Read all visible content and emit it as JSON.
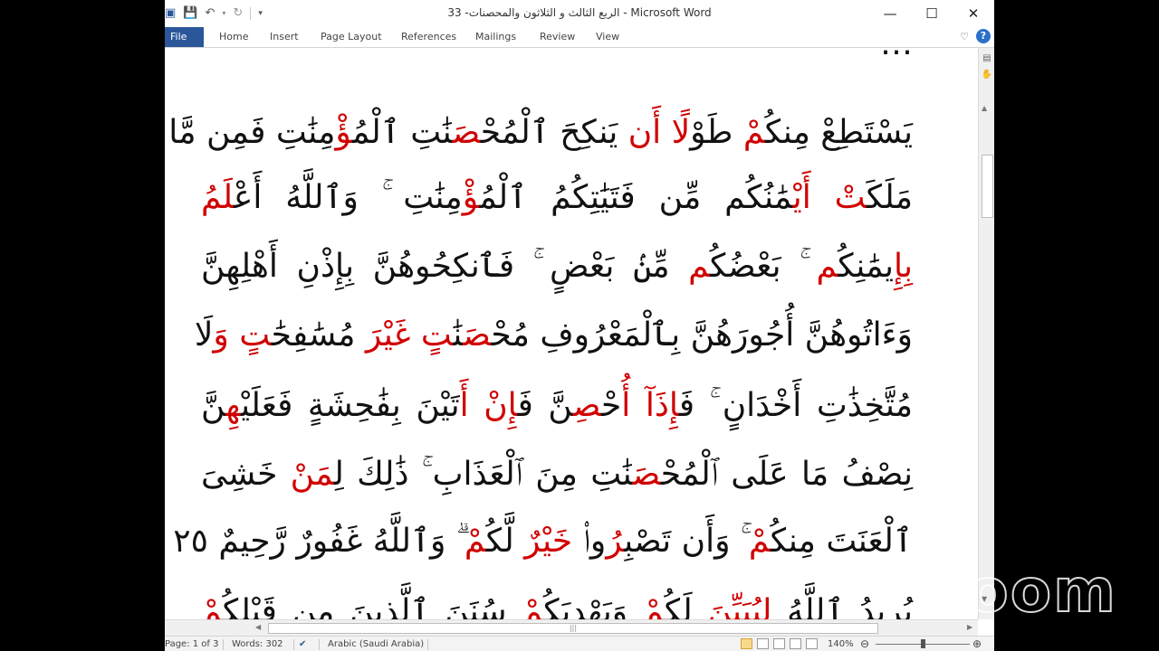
{
  "window": {
    "title": "الربع  الثالث و الثلاثون والمحصنات- 33  -  Microsoft Word"
  },
  "ribbon": {
    "tabs": [
      "File",
      "Home",
      "Insert",
      "Page Layout",
      "References",
      "Mailings",
      "Review",
      "View"
    ]
  },
  "document": {
    "lines": [
      [
        {
          "t": "…",
          "r": false
        }
      ],
      [
        {
          "t": "يَسْتَطِعْ مِنكُ",
          "r": false
        },
        {
          "t": "مْ",
          "r": true
        },
        {
          "t": " طَوْ",
          "r": false
        },
        {
          "t": "لًا أَن",
          "r": true
        },
        {
          "t": " يَنكِحَ ٱلْمُحْ",
          "r": false
        },
        {
          "t": "صَ",
          "r": true
        },
        {
          "t": "نَٰتِ ٱلْمُ",
          "r": false
        },
        {
          "t": "ؤْ",
          "r": true
        },
        {
          "t": "مِنَٰتِ فَمِن مَّا",
          "r": false
        }
      ],
      [
        {
          "t": "مَلَكَ",
          "r": false
        },
        {
          "t": "تْ أَيْ",
          "r": true
        },
        {
          "t": "مَٰنُكُم مِّن فَتَيَٰتِكُمُ ٱلْمُ",
          "r": false
        },
        {
          "t": "ؤْ",
          "r": true
        },
        {
          "t": "مِنَٰتِ ۚ وَٱللَّهُ أَعْ",
          "r": false
        },
        {
          "t": "لَمُ",
          "r": true
        }
      ],
      [
        {
          "t": "بِإِ",
          "r": true
        },
        {
          "t": "يمَٰنِكُ",
          "r": false
        },
        {
          "t": "م",
          "r": true
        },
        {
          "t": " ۚ بَعْضُكُ",
          "r": false
        },
        {
          "t": "م",
          "r": true
        },
        {
          "t": " مِّنۢ بَعْضٍ ۚ فَٱنكِحُوهُنَّ بِإِذْنِ أَهْلِهِنَّ",
          "r": false
        }
      ],
      [
        {
          "t": "وَءَاتُوهُنَّ أُجُورَهُنَّ بِٱلْمَعْرُوفِ مُحْ",
          "r": false
        },
        {
          "t": "صَ",
          "r": true
        },
        {
          "t": "نَٰ",
          "r": false
        },
        {
          "t": "تٍ غَيْرَ",
          "r": true
        },
        {
          "t": " مُسَٰفِحَٰ",
          "r": false
        },
        {
          "t": "تٍ وَ",
          "r": true
        },
        {
          "t": "لَا",
          "r": false
        }
      ],
      [
        {
          "t": "مُتَّخِذَٰتِ أَخْدَانٍ ۚ فَ",
          "r": false
        },
        {
          "t": "إِذَآ أُ",
          "r": true
        },
        {
          "t": "حْ",
          "r": false
        },
        {
          "t": "صِ",
          "r": true
        },
        {
          "t": "نَّ فَ",
          "r": false
        },
        {
          "t": "إِنْ أَ",
          "r": true
        },
        {
          "t": "تَيْنَ بِفَٰحِشَةٍ فَعَلَيْ",
          "r": false
        },
        {
          "t": "هِ",
          "r": true
        },
        {
          "t": "نَّ",
          "r": false
        }
      ],
      [
        {
          "t": "نِصْفُ مَا عَلَى ٱلْمُحْ",
          "r": false
        },
        {
          "t": "صَ",
          "r": true
        },
        {
          "t": "نَٰتِ مِنَ ٱلْعَذَابِ ۚ ذَٰلِكَ لِ",
          "r": false
        },
        {
          "t": "مَنْ",
          "r": true
        },
        {
          "t": " خَ",
          "r": false
        },
        {
          "t": "",
          "r": true
        },
        {
          "t": "شِىَ",
          "r": false
        }
      ],
      [
        {
          "t": "ٱلْعَنَتَ مِنكُ",
          "r": false
        },
        {
          "t": "مْ",
          "r": true
        },
        {
          "t": " ۚ وَأَن تَصْبِ",
          "r": false
        },
        {
          "t": "رُ",
          "r": true
        },
        {
          "t": "وا۟ ",
          "r": false
        },
        {
          "t": "خَيْرٌ",
          "r": true
        },
        {
          "t": " لَّكُ",
          "r": false
        },
        {
          "t": "مْ",
          "r": true
        },
        {
          "t": " ۗ وَٱللَّهُ غَفُورٌ رَّحِيمٌ ٢٥",
          "r": false
        }
      ],
      [
        {
          "t": "يُرِيدُ ٱللَّهُ ",
          "r": false
        },
        {
          "t": "لِيُبَيِّنَ",
          "r": true
        },
        {
          "t": " لَكُ",
          "r": false
        },
        {
          "t": "مْ",
          "r": true
        },
        {
          "t": " وَيَهْدِيَكُ",
          "r": false
        },
        {
          "t": "مْ",
          "r": true
        },
        {
          "t": " سُنَنَ ٱلَّذِينَ مِن قَبْلِكُ",
          "r": false
        },
        {
          "t": "مْ",
          "r": true
        }
      ]
    ]
  },
  "status": {
    "page": "Page: 1 of 3",
    "words": "Words: 302",
    "language": "Arabic (Saudi Arabia)",
    "zoom": "140%"
  },
  "overlay": {
    "logo_text": "zoom"
  },
  "colors": {
    "accent": "#2b579a",
    "quran_red": "#d00000"
  },
  "icons": {
    "app": "word-icon",
    "save": "save-icon",
    "undo": "undo-icon",
    "redo": "redo-icon",
    "customize": "customize-qat-icon",
    "minimize": "minimize-icon",
    "maximize": "maximize-icon",
    "close": "close-icon",
    "help": "help-icon"
  }
}
